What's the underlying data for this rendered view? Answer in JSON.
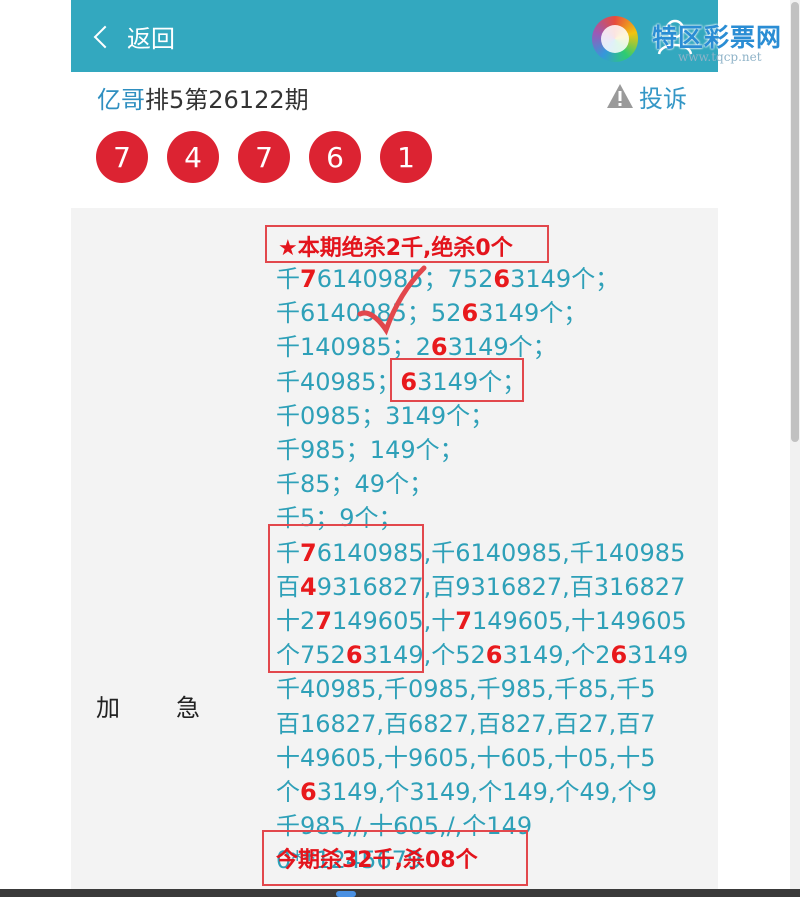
{
  "header": {
    "back_label": "返回",
    "logo_name": "特区彩票网",
    "logo_url": "www.tqcp.net"
  },
  "title": {
    "author": "亿哥",
    "rest": "排5第26122期",
    "complain_label": "投诉"
  },
  "balls": [
    "7",
    "4",
    "7",
    "6",
    "1"
  ],
  "side_label": [
    "加",
    "急"
  ],
  "banner_top": "★本期绝杀2千,绝杀0个",
  "banner_bottom": "今期杀32千,杀08个",
  "lines": [
    {
      "parts": [
        "千",
        "7",
        "614098",
        "5；752",
        "6",
        "3149个；"
      ]
    },
    {
      "parts": [
        "千6140985；52",
        "6",
        "3149个；"
      ]
    },
    {
      "parts": [
        "千140985；2",
        "6",
        "3149个；"
      ]
    },
    {
      "parts": [
        "千40985；",
        "6",
        "3149个；"
      ]
    },
    {
      "parts": [
        "千0985；3149个；"
      ]
    },
    {
      "parts": [
        "千985；149个；"
      ]
    },
    {
      "parts": [
        "千85；49个；"
      ]
    },
    {
      "parts": [
        "千5；9个；"
      ]
    },
    {
      "parts": [
        "千",
        "7",
        "6140985,千6140985,千140985"
      ]
    },
    {
      "parts": [
        "百",
        "4",
        "9316827,百9316827,百316827"
      ]
    },
    {
      "parts": [
        "十2",
        "7",
        "149605,十",
        "7",
        "149605,十149605"
      ]
    },
    {
      "parts": [
        "个752",
        "6",
        "3149,个52",
        "6",
        "3149,个2",
        "6",
        "3149"
      ]
    },
    {
      "parts": [
        "千40985,千0985,千985,千85,千5"
      ]
    },
    {
      "parts": [
        "百16827,百6827,百827,百27,百7"
      ]
    },
    {
      "parts": [
        "十49605,十9605,十605,十05,十5"
      ]
    },
    {
      "parts": [
        "个",
        "6",
        "3149,个3149,个149,个49,个9"
      ]
    },
    {
      "parts": [
        "千985,/,十605,/,个149"
      ]
    },
    {
      "parts": [
        "0**1245679"
      ]
    }
  ],
  "colors": {
    "header_bg": "#33a8bf",
    "ball": "#dc2332",
    "number_text": "#2ea0b8",
    "highlight": "#e8191c",
    "annotation_box": "#e2474c"
  }
}
